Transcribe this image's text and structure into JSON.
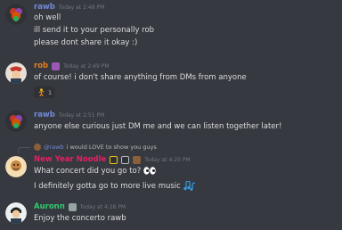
{
  "messages": [
    {
      "author": "rawb",
      "author_color": "#7289da",
      "timestamp": "Today at 2:48 PM",
      "lines": [
        "oh well",
        "ill send it to your personally rob",
        "please dont share it okay :)"
      ]
    },
    {
      "author": "rob",
      "author_color": "#e67e22",
      "timestamp": "Today at 2:49 PM",
      "lines": [
        "of course! i don't share anything from DMs from anyone"
      ],
      "reaction": {
        "emoji": "dancing-figure",
        "count": "1"
      }
    },
    {
      "author": "rawb",
      "author_color": "#7289da",
      "timestamp": "Today at 2:51 PM",
      "lines": [
        "anyone else curious just DM me and we can listen together later!"
      ]
    },
    {
      "reply": {
        "author": "@rawb",
        "text": "i would LOVE to show you guys"
      },
      "author": "New Year Noodle",
      "author_color": "#e91e63",
      "timestamp": "Today at 4:25 PM",
      "lines": [
        "What concert did you go to?",
        "I definitely gotta go to more live music"
      ]
    },
    {
      "author": "Auronn",
      "author_color": "#2ecc71",
      "timestamp": "Today at 4:28 PM",
      "lines": [
        "Enjoy the concerto rawb"
      ]
    }
  ],
  "colors": {
    "background": "#36393f",
    "text": "#dcddde",
    "timestamp": "#72767d",
    "mention": "#7289da"
  }
}
